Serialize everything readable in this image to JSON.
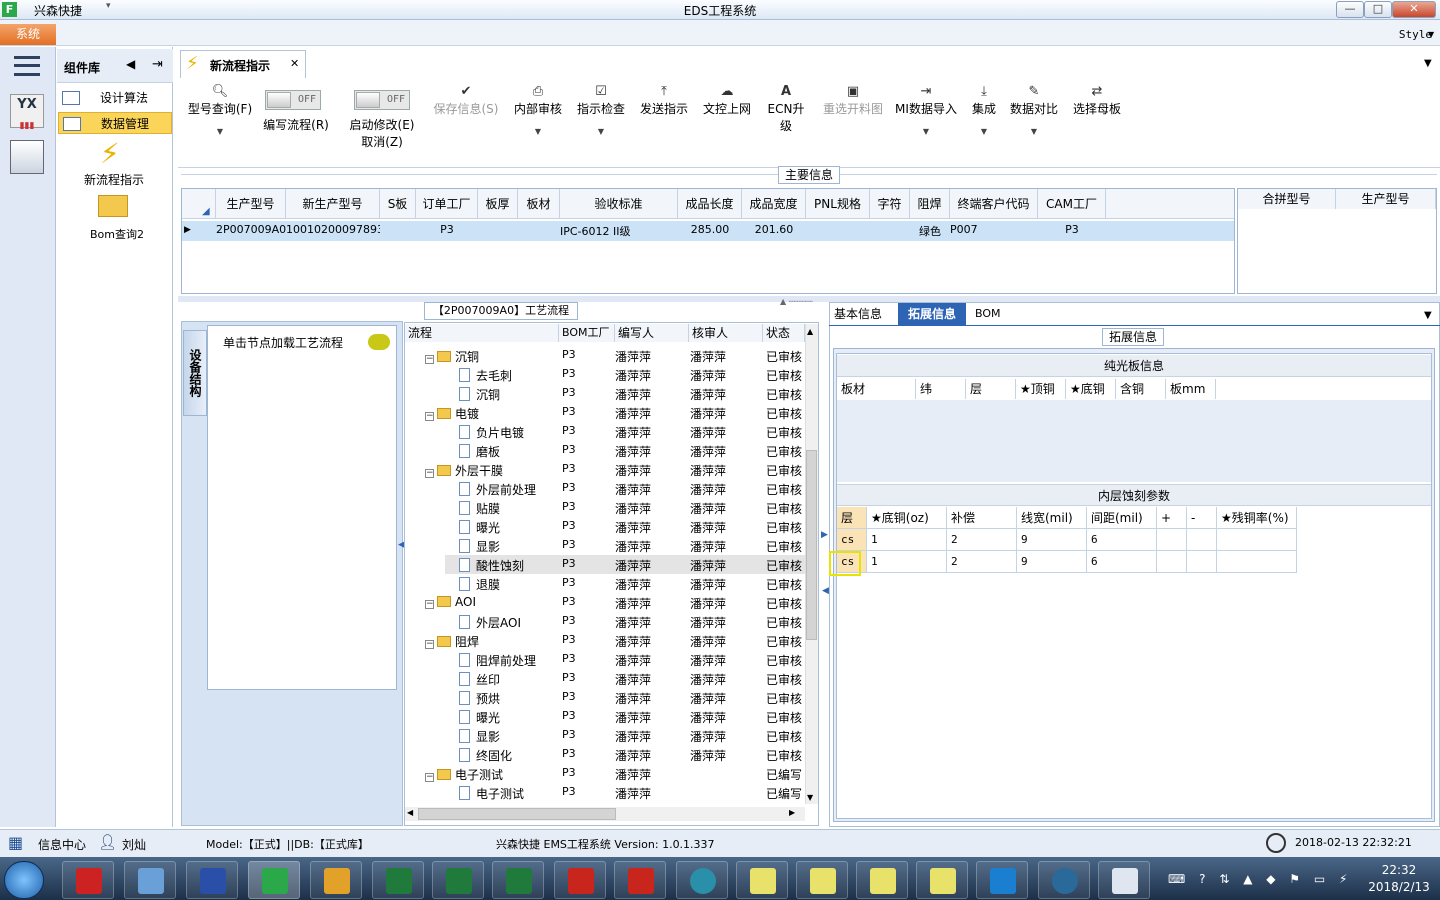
{
  "titlebar": {
    "app_name": "兴森快捷",
    "window_title": "EDS工程系统",
    "controls": [
      "—",
      "□",
      "✕"
    ]
  },
  "menubar": {
    "system_tab": "系统",
    "style_label": "Style"
  },
  "component_library": {
    "title": "组件库",
    "items": [
      {
        "label": "设计算法"
      },
      {
        "label": "数据管理",
        "selected": true
      }
    ],
    "tools": [
      {
        "label": "新流程指示",
        "icon": "lightning-icon"
      },
      {
        "label": "Bom查询2",
        "icon": "folder-open-icon"
      }
    ]
  },
  "doc_tab": {
    "label": "新流程指示"
  },
  "ribbon": {
    "buttons": [
      {
        "label": "型号查询(F)",
        "icon": "search-icon",
        "dropdown": true
      },
      {
        "label": "保存信息(S)",
        "icon": "check-icon",
        "disabled": true
      },
      {
        "label": "内部审核",
        "icon": "printer-icon",
        "dropdown": true
      },
      {
        "label": "指示检查",
        "icon": "checkbox-icon",
        "dropdown": true
      },
      {
        "label": "发送指示",
        "icon": "upload-icon"
      },
      {
        "label": "文控上网",
        "icon": "cloud-upload-icon"
      },
      {
        "label": "ECN升级",
        "icon": "ecn-icon"
      },
      {
        "label": "重选开料图",
        "icon": "image-icon",
        "disabled": true
      },
      {
        "label": "MI数据导入",
        "icon": "import-icon",
        "dropdown": true
      },
      {
        "label": "集成",
        "icon": "download-icon",
        "dropdown": true
      },
      {
        "label": "数据对比",
        "icon": "compare-icon",
        "dropdown": true
      },
      {
        "label": "选择母板",
        "icon": "shuffle-icon"
      }
    ],
    "toggles": [
      {
        "state": "OFF",
        "label": "编写流程(R)"
      },
      {
        "state": "OFF",
        "label": "启动修改(E)",
        "label2": "取消(Z)"
      }
    ]
  },
  "main_info": {
    "section_title": "主要信息",
    "columns": [
      "生产型号",
      "新生产型号",
      "S板",
      "订单工厂",
      "板厚",
      "板材",
      "验收标准",
      "成品长度",
      "成品宽度",
      "PNL规格",
      "字符",
      "阻焊",
      "终端客户代码",
      "CAM工厂"
    ],
    "row": [
      "2P007009A0",
      "10010200097893",
      "",
      "P3",
      "",
      "",
      "IPC-6012 II级",
      "285.00",
      "201.60",
      "",
      "",
      "绿色",
      "P007",
      "P3"
    ],
    "side_columns": [
      "合拼型号",
      "生产型号"
    ]
  },
  "process": {
    "title": "【2P007009A0】工艺流程",
    "equip_tab": "设备结构",
    "node_hint": "单击节点加载工艺流程",
    "columns": [
      "流程",
      "BOM工厂",
      "编写人",
      "核审人",
      "状态"
    ],
    "rows": [
      {
        "name": "沉铜",
        "level": 0,
        "folder": true,
        "factory": "P3",
        "author": "潘萍萍",
        "reviewer": "潘萍萍",
        "status": "已审核"
      },
      {
        "name": "去毛刺",
        "level": 1,
        "factory": "P3",
        "author": "潘萍萍",
        "reviewer": "潘萍萍",
        "status": "已审核"
      },
      {
        "name": "沉铜",
        "level": 1,
        "factory": "P3",
        "author": "潘萍萍",
        "reviewer": "潘萍萍",
        "status": "已审核"
      },
      {
        "name": "电镀",
        "level": 0,
        "folder": true,
        "factory": "P3",
        "author": "潘萍萍",
        "reviewer": "潘萍萍",
        "status": "已审核"
      },
      {
        "name": "负片电镀",
        "level": 1,
        "factory": "P3",
        "author": "潘萍萍",
        "reviewer": "潘萍萍",
        "status": "已审核"
      },
      {
        "name": "磨板",
        "level": 1,
        "factory": "P3",
        "author": "潘萍萍",
        "reviewer": "潘萍萍",
        "status": "已审核"
      },
      {
        "name": "外层干膜",
        "level": 0,
        "folder": true,
        "factory": "P3",
        "author": "潘萍萍",
        "reviewer": "潘萍萍",
        "status": "已审核"
      },
      {
        "name": "外层前处理",
        "level": 1,
        "factory": "P3",
        "author": "潘萍萍",
        "reviewer": "潘萍萍",
        "status": "已审核"
      },
      {
        "name": "贴膜",
        "level": 1,
        "factory": "P3",
        "author": "潘萍萍",
        "reviewer": "潘萍萍",
        "status": "已审核"
      },
      {
        "name": "曝光",
        "level": 1,
        "factory": "P3",
        "author": "潘萍萍",
        "reviewer": "潘萍萍",
        "status": "已审核"
      },
      {
        "name": "显影",
        "level": 1,
        "factory": "P3",
        "author": "潘萍萍",
        "reviewer": "潘萍萍",
        "status": "已审核"
      },
      {
        "name": "酸性蚀刻",
        "level": 1,
        "factory": "P3",
        "author": "潘萍萍",
        "reviewer": "潘萍萍",
        "status": "已审核",
        "selected": true
      },
      {
        "name": "退膜",
        "level": 1,
        "factory": "P3",
        "author": "潘萍萍",
        "reviewer": "潘萍萍",
        "status": "已审核"
      },
      {
        "name": "AOI",
        "level": 0,
        "folder": true,
        "factory": "P3",
        "author": "潘萍萍",
        "reviewer": "潘萍萍",
        "status": "已审核"
      },
      {
        "name": "外层AOI",
        "level": 1,
        "factory": "P3",
        "author": "潘萍萍",
        "reviewer": "潘萍萍",
        "status": "已审核"
      },
      {
        "name": "阻焊",
        "level": 0,
        "folder": true,
        "factory": "P3",
        "author": "潘萍萍",
        "reviewer": "潘萍萍",
        "status": "已审核"
      },
      {
        "name": "阻焊前处理",
        "level": 1,
        "factory": "P3",
        "author": "潘萍萍",
        "reviewer": "潘萍萍",
        "status": "已审核"
      },
      {
        "name": "丝印",
        "level": 1,
        "factory": "P3",
        "author": "潘萍萍",
        "reviewer": "潘萍萍",
        "status": "已审核"
      },
      {
        "name": "预烘",
        "level": 1,
        "factory": "P3",
        "author": "潘萍萍",
        "reviewer": "潘萍萍",
        "status": "已审核"
      },
      {
        "name": "曝光",
        "level": 1,
        "factory": "P3",
        "author": "潘萍萍",
        "reviewer": "潘萍萍",
        "status": "已审核"
      },
      {
        "name": "显影",
        "level": 1,
        "factory": "P3",
        "author": "潘萍萍",
        "reviewer": "潘萍萍",
        "status": "已审核"
      },
      {
        "name": "终固化",
        "level": 1,
        "factory": "P3",
        "author": "潘萍萍",
        "reviewer": "潘萍萍",
        "status": "已审核"
      },
      {
        "name": "电子测试",
        "level": 0,
        "folder": true,
        "factory": "P3",
        "author": "潘萍萍",
        "reviewer": "",
        "status": "已编写"
      },
      {
        "name": "电子测试",
        "level": 1,
        "factory": "P3",
        "author": "潘萍萍",
        "reviewer": "",
        "status": "已编写"
      }
    ]
  },
  "right_panel": {
    "tabs": [
      {
        "label": "基本信息"
      },
      {
        "label": "拓展信息",
        "active": true
      },
      {
        "label": "BOM"
      }
    ],
    "section_title": "拓展信息",
    "plain_board": {
      "title": "纯光板信息",
      "columns": [
        "板材",
        "纬",
        "层",
        "★顶铜",
        "★底铜",
        "含铜",
        "板mm"
      ]
    },
    "inner_etch": {
      "title": "内层蚀刻参数",
      "columns": [
        "层",
        "★底铜(oz)",
        "补偿",
        "线宽(mil)",
        "间距(mil)",
        "+",
        "-",
        "★残铜率(%)"
      ],
      "rows": [
        [
          "cs",
          "1",
          "2",
          "9",
          "6",
          "",
          "",
          ""
        ],
        [
          "cs",
          "1",
          "2",
          "9",
          "6",
          "",
          "",
          ""
        ]
      ]
    }
  },
  "statusbar": {
    "info_center": "信息中心",
    "user": "刘灿",
    "model": "Model:【正式】||DB:【正式库】",
    "system": "兴森快捷 EMS工程系统 Version: 1.0.1.337",
    "datetime": "2018-02-13 22:32:21"
  },
  "taskbar": {
    "time": "22:32",
    "date": "2018/2/13"
  }
}
